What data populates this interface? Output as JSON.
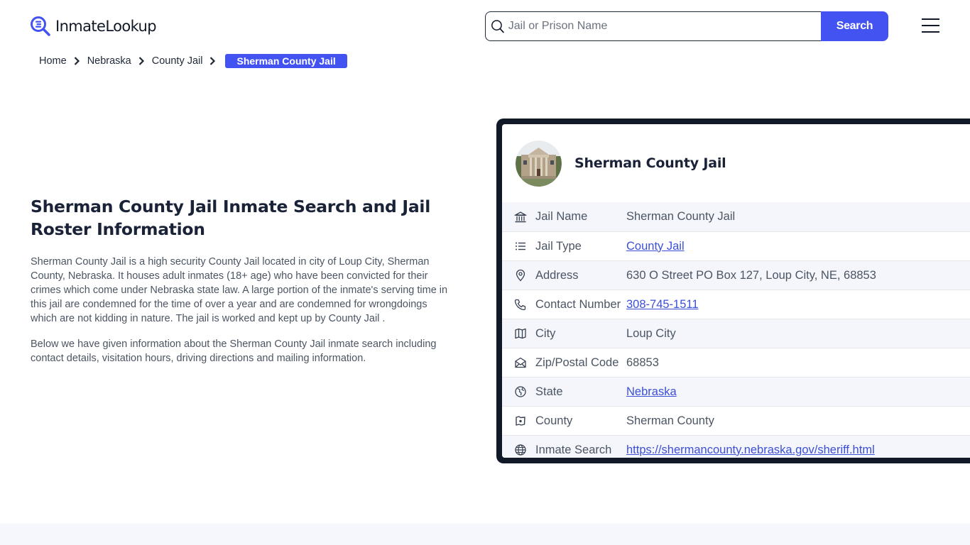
{
  "brand": {
    "name": "InmateLookup",
    "accent_color": "#4353f2",
    "dark_color": "#111827"
  },
  "search": {
    "placeholder": "Jail or Prison Name",
    "value": "",
    "button_label": "Search"
  },
  "menu": {
    "icon": "hamburger-menu-icon"
  },
  "breadcrumb": {
    "items": [
      {
        "label": "Home"
      },
      {
        "label": "Nebraska"
      },
      {
        "label": "County Jail"
      }
    ],
    "current": "Sherman County Jail"
  },
  "intro": {
    "title": "Sherman County Jail Inmate Search and Jail Roster Information",
    "paragraphs": [
      "Sherman County Jail is a high security County Jail located in city of Loup City, Sherman County, Nebraska. It houses adult inmates (18+ age) who have been convicted for their crimes which come under Nebraska state law. A large portion of the inmate's serving time in this jail are condemned for the time of over a year and are condemned for wrongdoings which are not kidding in nature. The jail is worked and kept up by County Jail .",
      "Below we have given information about the Sherman County Jail inmate search including contact details, visitation hours, driving directions and mailing information."
    ]
  },
  "card": {
    "title": "Sherman County Jail",
    "avatar_alt": "Sherman County courthouse photo",
    "rows": [
      {
        "icon": "building-columns-icon",
        "label": "Jail Name",
        "value": "Sherman County Jail",
        "link": false
      },
      {
        "icon": "list-icon",
        "label": "Jail Type",
        "value": "County Jail",
        "link": true
      },
      {
        "icon": "map-pin-icon",
        "label": "Address",
        "value": "630 O Street PO Box 127, Loup City, NE, 68853",
        "link": false
      },
      {
        "icon": "phone-icon",
        "label": "Contact Number",
        "value": "308-745-1511",
        "link": true
      },
      {
        "icon": "map-icon",
        "label": "City",
        "value": "Loup City",
        "link": false
      },
      {
        "icon": "mail-open-icon",
        "label": "Zip/Postal Code",
        "value": "68853",
        "link": false
      },
      {
        "icon": "globe-region-icon",
        "label": "State",
        "value": "Nebraska",
        "link": true
      },
      {
        "icon": "county-map-icon",
        "label": "County",
        "value": "Sherman County",
        "link": false
      },
      {
        "icon": "world-icon",
        "label": "Inmate Search",
        "value": "https://shermancounty.nebraska.gov/sheriff.html",
        "link": true
      }
    ]
  }
}
